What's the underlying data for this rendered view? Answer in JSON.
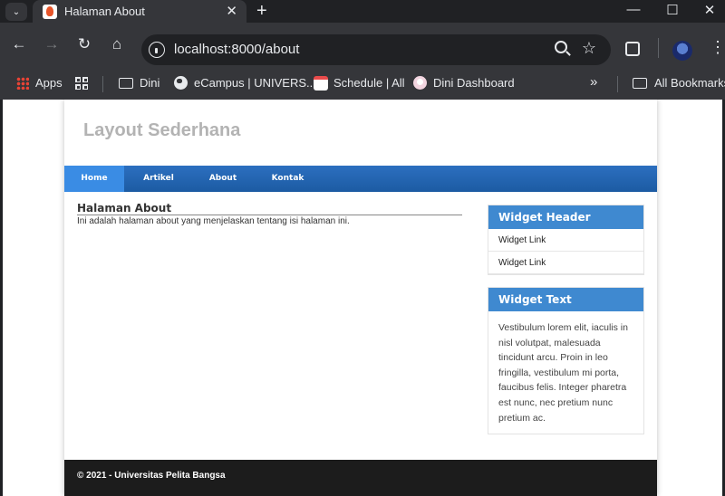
{
  "browser": {
    "tab_title": "Halaman About",
    "url": "localhost:8000/about",
    "bookmarks": [
      {
        "label": "Apps",
        "icon": "apps-grid-icon"
      },
      {
        "label": "",
        "icon": "tab-groups-icon"
      },
      {
        "label": "Dini",
        "icon": "folder-icon"
      },
      {
        "label": "eCampus | UNIVERS...",
        "icon": "globe-icon"
      },
      {
        "label": "Schedule | All",
        "icon": "calendar-icon"
      },
      {
        "label": "Dini Dashboard",
        "icon": "dini-icon"
      }
    ],
    "more_bookmarks": "»",
    "all_bookmarks": "All Bookmarks"
  },
  "page": {
    "site_title": "Layout Sederhana",
    "nav": [
      {
        "label": "Home",
        "active": true
      },
      {
        "label": "Artikel",
        "active": false
      },
      {
        "label": "About",
        "active": false
      },
      {
        "label": "Kontak",
        "active": false
      }
    ],
    "article": {
      "title": "Halaman About",
      "text": "Ini adalah halaman about yang menjelaskan tentang isi halaman ini."
    },
    "widget_links": {
      "header": "Widget Header",
      "links": [
        "Widget Link",
        "Widget Link"
      ]
    },
    "widget_text": {
      "header": "Widget Text",
      "body": "Vestibulum lorem elit, iaculis in nisl volutpat, malesuada tincidunt arcu. Proin in leo fringilla, vestibulum mi porta, faucibus felis. Integer pharetra est nunc, nec pretium nunc pretium ac."
    },
    "footer": "© 2021 - Universitas Pelita Bangsa"
  },
  "colors": {
    "nav_bar": "#1c5ba3",
    "nav_active": "#3a8ce4",
    "widget_header": "#3f89d0",
    "footer": "#1c1c1c"
  }
}
